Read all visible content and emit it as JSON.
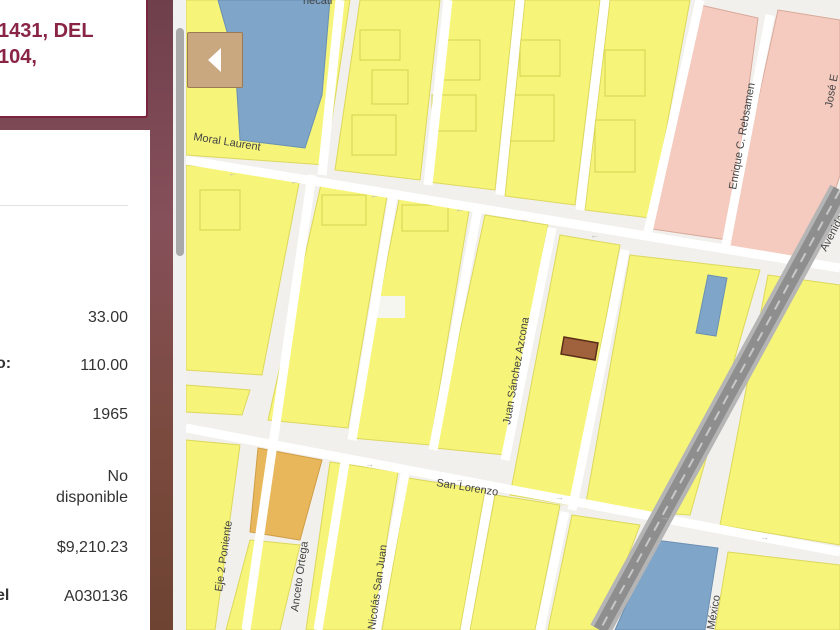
{
  "header": {
    "title": "1431, DEL\n104,"
  },
  "info": {
    "rows": [
      {
        "label": "",
        "value": "33.00"
      },
      {
        "label": "o:",
        "value": "110.00"
      },
      {
        "label": "",
        "value": "1965"
      },
      {
        "label": "",
        "value": "No\ndisponible"
      },
      {
        "label": "",
        "value": "$9,210.23"
      },
      {
        "label": "el",
        "value": "A030136"
      }
    ]
  },
  "map": {
    "streets": {
      "top": "necatl",
      "laurent": "Moral Laurent",
      "rebsamen": "Enrique C. Rebsamen",
      "jose": "José E",
      "avenida": "Avenida",
      "juan": "Juan Sánchez Azcona",
      "lorenzo": "San Lorenzo",
      "eje2": "Eje 2 Poniente",
      "anceto": "Anceto Ortega",
      "nicolas": "Nicolás San Juan",
      "mexico": "México"
    },
    "colors": {
      "residential": "#f6f57a",
      "residential_edge": "#e0dc5a",
      "commercial": "#f5cbbf",
      "equipment": "#7fa6c9",
      "orange_block": "#e8b75c",
      "selected_parcel": "#a0623d",
      "road": "#ffffff",
      "highway": "#9b9b9b"
    }
  },
  "controls": {
    "collapse_icon": "chevron-left-icon"
  }
}
